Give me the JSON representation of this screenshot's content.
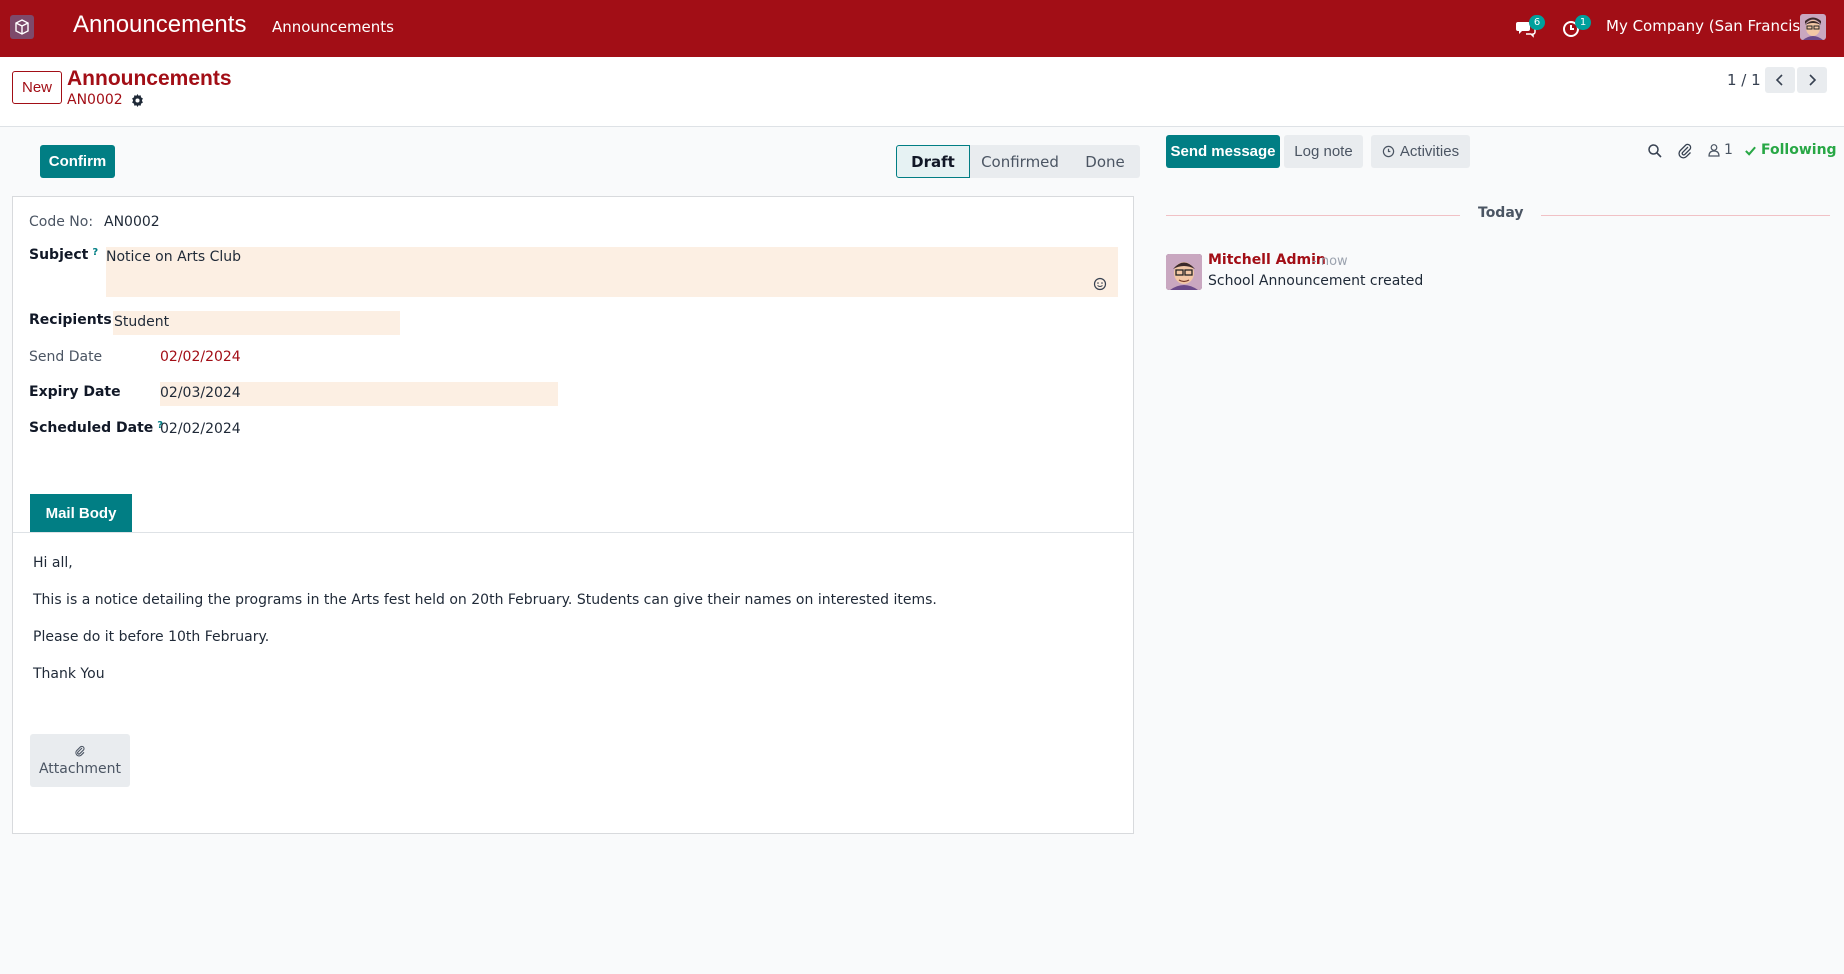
{
  "navbar": {
    "app_title": "Announcements",
    "menu_item": "Announcements",
    "messages_count": "6",
    "activities_count": "1",
    "company": "My Company (San Francisco)"
  },
  "control": {
    "new_label": "New",
    "breadcrumb_title": "Announcements",
    "record_ref": "AN0002",
    "pager": "1 / 1"
  },
  "statusbar": {
    "confirm_label": "Confirm",
    "stages": [
      "Draft",
      "Confirmed",
      "Done"
    ],
    "active_stage": "Draft"
  },
  "form": {
    "code_label": "Code No:",
    "code_value": "AN0002",
    "subject_label": "Subject",
    "subject_help": "?",
    "subject_value": "Notice on Arts Club",
    "recipients_label": "Recipients",
    "recipients_value": "Student",
    "send_date_label": "Send Date",
    "send_date_value": "02/02/2024",
    "expiry_date_label": "Expiry Date",
    "expiry_date_value": "02/03/2024",
    "scheduled_date_label": "Scheduled Date",
    "scheduled_date_help": "?",
    "scheduled_date_value": "02/02/2024",
    "tab_label": "Mail Body",
    "body_lines": [
      "Hi all,",
      "This is a notice  detailing the programs in the Arts fest held on 20th February. Students can give their names on interested items.",
      "Please do it before 10th February.",
      "Thank You"
    ],
    "attachment_label": "Attachment"
  },
  "chatter": {
    "send_message_label": "Send message",
    "log_note_label": "Log note",
    "activities_label": "Activities",
    "followers_count": "1",
    "following_label": "Following",
    "date_separator": "Today",
    "message": {
      "author": "Mitchell Admin",
      "time": "- now",
      "body": "School Announcement created"
    }
  },
  "colors": {
    "brand": "#a20e16",
    "primary": "#017e84",
    "field_highlight": "#fcefe3"
  }
}
